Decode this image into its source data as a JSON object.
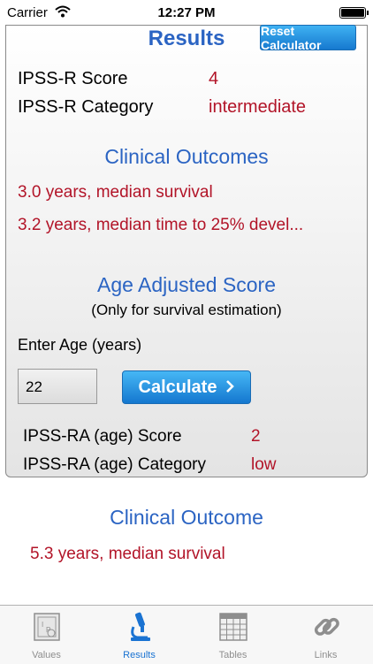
{
  "status_bar": {
    "carrier": "Carrier",
    "time": "12:27 PM"
  },
  "header": {
    "title": "Results",
    "reset_label": "Reset Calculator"
  },
  "score": {
    "score_label": "IPSS-R Score",
    "score_value": "4",
    "category_label": "IPSS-R Category",
    "category_value": "intermediate"
  },
  "clinical_outcomes": {
    "heading": "Clinical Outcomes",
    "line1": "3.0 years, median survival",
    "line2": "3.2 years, median time to 25% devel..."
  },
  "age_adjusted": {
    "heading": "Age Adjusted Score",
    "note": "(Only for survival estimation)",
    "enter_age_label": "Enter Age (years)",
    "age_value": "22",
    "calculate_label": "Calculate",
    "ra_score_label": "IPSS-RA (age) Score",
    "ra_score_value": "2",
    "ra_category_label": "IPSS-RA (age) Category",
    "ra_category_value": "low"
  },
  "clinical_outcome": {
    "heading": "Clinical Outcome",
    "line1": "5.3 years, median survival"
  },
  "tabs": [
    {
      "label": "Values",
      "icon": "values-icon",
      "active": false
    },
    {
      "label": "Results",
      "icon": "microscope-icon",
      "active": true
    },
    {
      "label": "Tables",
      "icon": "table-grid-icon",
      "active": false
    },
    {
      "label": "Links",
      "icon": "chain-link-icon",
      "active": false
    }
  ],
  "colors": {
    "heading_blue": "#2b64c3",
    "value_red": "#b21428",
    "active_tab": "#1a73d2"
  }
}
